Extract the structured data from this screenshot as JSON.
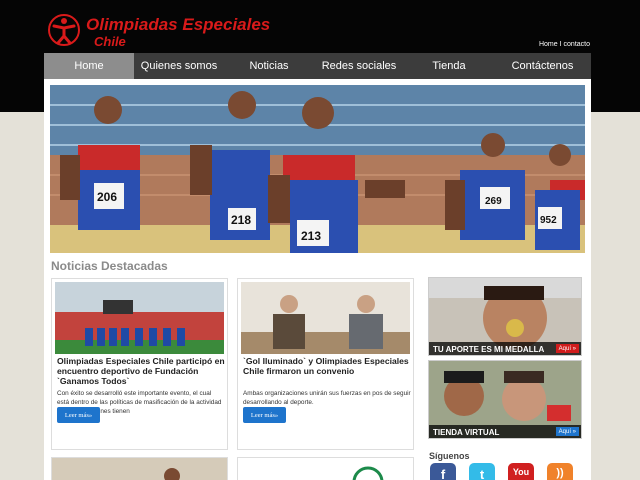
{
  "brand": {
    "title": "Olimpiadas Especiales",
    "subtitle": "Chile",
    "emblem_icon": "special-olympics-emblem",
    "color": "#d91a1a"
  },
  "toplinks": {
    "home": "Home",
    "separator": "I",
    "contact": "contacto"
  },
  "nav": {
    "items": [
      {
        "label": "Home",
        "active": true
      },
      {
        "label": "Quienes somos"
      },
      {
        "label": "Noticias"
      },
      {
        "label": "Redes sociales"
      },
      {
        "label": "Tienda"
      },
      {
        "label": "Contáctenos"
      }
    ]
  },
  "hero": {
    "bibs": [
      "206",
      "218",
      "213",
      "269",
      "952"
    ]
  },
  "news": {
    "section_title": "Noticias Destacadas",
    "cards": [
      {
        "title": "Olimpiadas Especiales Chile participó en encuentro deportivo de Fundación `Ganamos Todos`",
        "body": "Con éxito se desarrolló este importante evento, el cual está dentro de las políticas de masificación de la actividad física para quienes tienen",
        "button": "Leer más»"
      },
      {
        "title": "`Gol Iluminado` y Olimpiades Especiales Chile firmaron un convenio",
        "body": "Ambas organizaciones unirán sus fuerzas en pos de seguir desarrollando al deporte.",
        "button": "Leer más»"
      }
    ]
  },
  "promos": [
    {
      "label": "TU APORTE ES MI MEDALLA",
      "button": "Aquí »",
      "button_color": "#d01c1c"
    },
    {
      "label": "TIENDA VIRTUAL",
      "button": "Aquí »",
      "button_color": "#1e74cc"
    }
  ],
  "social": {
    "title": "Síguenos",
    "items": [
      {
        "icon": "facebook-icon",
        "glyph": "f",
        "color": "#3b5998"
      },
      {
        "icon": "twitter-icon",
        "glyph": "t",
        "color": "#33bbe8"
      },
      {
        "icon": "youtube-icon",
        "glyph": "You",
        "color": "#d02020"
      },
      {
        "icon": "rss-icon",
        "glyph": "))",
        "color": "#f0822a"
      }
    ]
  }
}
